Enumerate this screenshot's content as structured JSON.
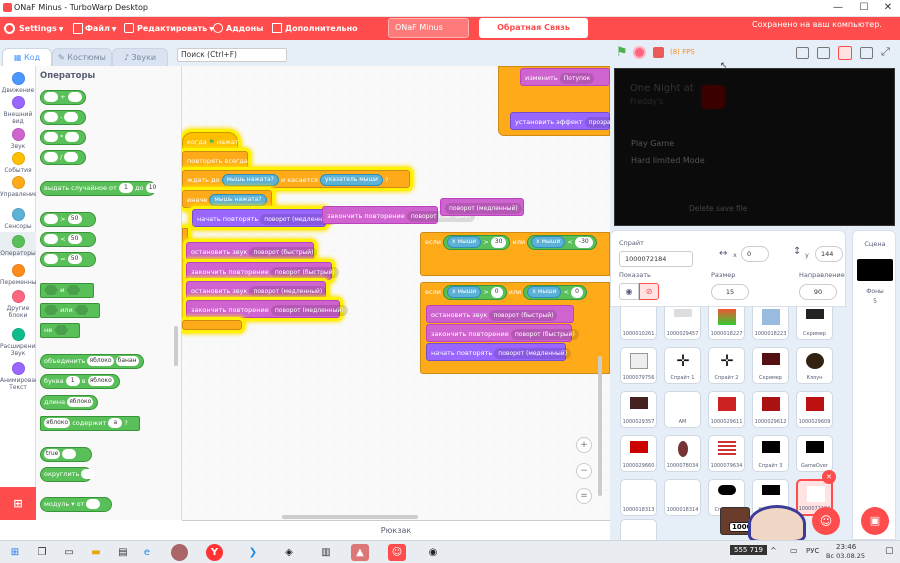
{
  "window": {
    "title": "ONaF Minus - TurboWarp Desktop",
    "min": "—",
    "max": "☐",
    "close": "✕"
  },
  "menu": {
    "settings": "Settings",
    "file": "Файл",
    "edit": "Редактировать",
    "addons": "Аддоны",
    "tutorials": "Дополнительно",
    "project_title": "ONaF Minus",
    "feedback": "Обратная Связь TurboWarp",
    "offline": "Сохранено на ваш компьютер."
  },
  "tabs": {
    "code": "Код",
    "costumes": "Костюмы",
    "sounds": "Звуки"
  },
  "search": {
    "placeholder": "Поиск (Ctrl+F)"
  },
  "categories": [
    {
      "label": "Движение",
      "color": "#4c97ff"
    },
    {
      "label": "Внешний вид",
      "color": "#9966ff"
    },
    {
      "label": "Звук",
      "color": "#cf63cf"
    },
    {
      "label": "События",
      "color": "#ffbf00"
    },
    {
      "label": "Управление",
      "color": "#ffab19"
    },
    {
      "label": "Сенсоры",
      "color": "#5cb1d6"
    },
    {
      "label": "Операторы",
      "color": "#59c059"
    },
    {
      "label": "Переменные",
      "color": "#ff8c1a"
    },
    {
      "label": "Другие блоки",
      "color": "#ff6680"
    },
    {
      "label": "Расширения Звук",
      "color": "#0fbd8c"
    },
    {
      "label": "Анимирован Текст",
      "color": "#9966ff"
    }
  ],
  "palette": {
    "title": "Операторы",
    "random": {
      "text1": "выдать случайное от",
      "a": "1",
      "to": "до",
      "b": "10"
    },
    "cmp_values": [
      "50",
      "50",
      "50"
    ],
    "and": "и",
    "or": "или",
    "not": "не",
    "join": {
      "text": "объединить",
      "a": "яблоко",
      "b": "банан"
    },
    "letter": {
      "text": "буква",
      "n": "1",
      "of": "в",
      "s": "яблоко"
    },
    "length": {
      "text": "длина",
      "s": "яблоко"
    },
    "contains": {
      "s": "яблоко",
      "text": "содержит",
      "c": "а"
    },
    "true": "true",
    "round": "округлить",
    "mod": {
      "text": "модуль",
      "f": "от"
    }
  },
  "workspace": {
    "top_block1": "изменить",
    "top_block1_dd": "Потупок",
    "top_block2": "установить эффект",
    "top_block2_dd": "прозрачн",
    "hat": "когда",
    "hat2": "нажат",
    "forever": "повторять всегда",
    "wait_until": "ждать до",
    "mouse_down": "мышь нажата?",
    "and": "и",
    "touching": "касается",
    "mouse_ptr": "указатель мыши",
    "qmark": "?",
    "if": "если",
    "else_text": "иначе",
    "stop_loop": "закончить повторение",
    "turn_fast": "поворот (быстрый)",
    "turn_slow": "поворот (медленный)",
    "start_loop": "начать повторять",
    "stop_sound": "остановить звук",
    "mouse_x": "x мыши",
    "gt": ">",
    "lt": "<",
    "val30": "30",
    "val_neg30": "-30",
    "val0": "0",
    "or": "или",
    "rucksack": "Рюкзак"
  },
  "stage": {
    "fps": "(8) FPS",
    "title_line1": "One Night at",
    "title_line2": "Freddy's",
    "menu_items": [
      "Play Game",
      "Hard limited Mode"
    ],
    "delete": "Delete save file"
  },
  "sprite": {
    "label": "Спрайт",
    "name": "1000072184",
    "x_label": "x",
    "x": "0",
    "y_label": "y",
    "y": "144",
    "show": "Показать",
    "size_label": "Размер",
    "size": "15",
    "dir_label": "Направление",
    "dir": "90"
  },
  "sprites": [
    {
      "name": "1000010261"
    },
    {
      "name": "1000029457"
    },
    {
      "name": "1000018227"
    },
    {
      "name": "1000018223"
    },
    {
      "name": "Скример"
    },
    {
      "name": "1000079756"
    },
    {
      "name": "Спрайт 1"
    },
    {
      "name": "Спрайт 2"
    },
    {
      "name": "Скример"
    },
    {
      "name": "Клоун"
    },
    {
      "name": "1000029357"
    },
    {
      "name": "АМ"
    },
    {
      "name": "1000029611"
    },
    {
      "name": "1000029612"
    },
    {
      "name": "1000029609"
    },
    {
      "name": "1000029660"
    },
    {
      "name": "1000078034"
    },
    {
      "name": "1000079634"
    },
    {
      "name": "Спрайт 3"
    },
    {
      "name": "GameOver"
    },
    {
      "name": "1000018313"
    },
    {
      "name": "1000018314"
    },
    {
      "name": "Спрайт 4"
    },
    {
      "name": "Спрайт 5"
    },
    {
      "name": "1000072184"
    }
  ],
  "stage_panel": {
    "title": "Сцена",
    "backdrops_label": "Фоны",
    "backdrops": "5"
  },
  "taskbar": {
    "counter": "555 719",
    "badge": "1000",
    "lang": "РУС",
    "time": "23:46",
    "date": "Вс 03.08.25"
  }
}
